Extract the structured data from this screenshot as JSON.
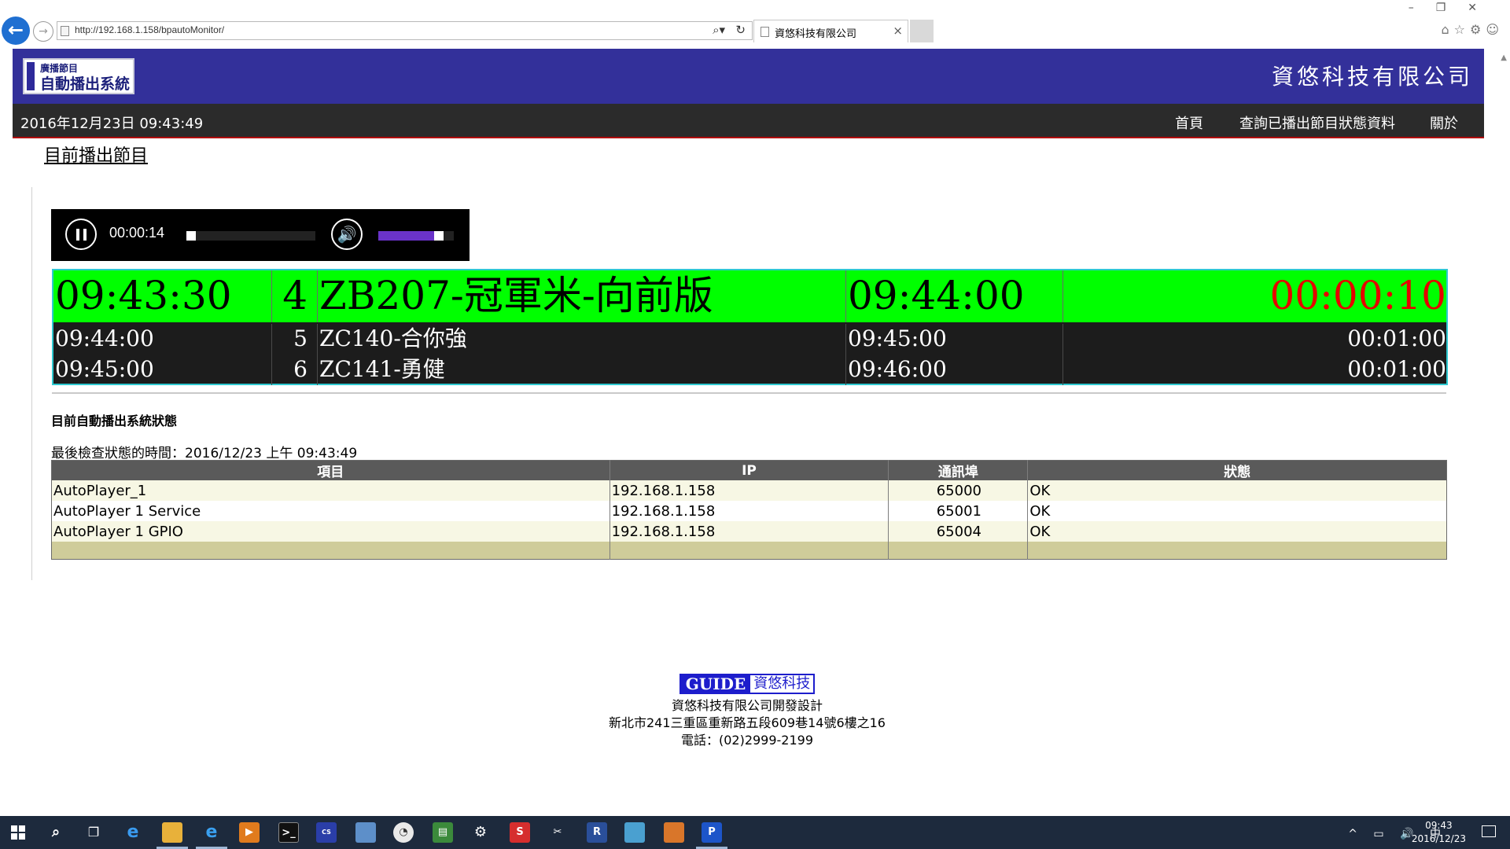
{
  "browser": {
    "url": "http://192.168.1.158/bpautoMonitor/",
    "tab_title": "資悠科技有限公司"
  },
  "header": {
    "logo_line1": "廣播節目",
    "logo_line2": "自動播出系統",
    "company": "資悠科技有限公司"
  },
  "nav": {
    "clock": "2016年12月23日 09:43:49",
    "items": [
      "首頁",
      "查詢已播出節目狀態資料",
      "關於"
    ]
  },
  "section_title": "目前播出節目",
  "player": {
    "time": "00:00:14",
    "seek_progress": 0.0,
    "volume": 0.85
  },
  "schedule": {
    "current": {
      "start": "09:43:30",
      "number": "4",
      "title": "ZB207-冠軍米-向前版",
      "end": "09:44:00",
      "remaining": "00:00:10"
    },
    "next": [
      {
        "start": "09:44:00",
        "number": "5",
        "title": "ZC140-合你強",
        "end": "09:45:00",
        "duration": "00:01:00"
      },
      {
        "start": "09:45:00",
        "number": "6",
        "title": "ZC141-勇健",
        "end": "09:46:00",
        "duration": "00:01:00"
      }
    ]
  },
  "status": {
    "heading": "目前自動播出系統狀態",
    "last_check_label": "最後檢查狀態的時間：",
    "last_check_value": "2016/12/23 上午 09:43:49",
    "columns": [
      "項目",
      "IP",
      "通訊埠",
      "狀態"
    ],
    "rows": [
      {
        "item": "AutoPlayer_1",
        "ip": "192.168.1.158",
        "port": "65000",
        "state": "OK"
      },
      {
        "item": "AutoPlayer 1 Service",
        "ip": "192.168.1.158",
        "port": "65001",
        "state": "OK"
      },
      {
        "item": "AutoPlayer 1 GPIO",
        "ip": "192.168.1.158",
        "port": "65004",
        "state": "OK"
      }
    ]
  },
  "footer": {
    "logo_en": "GUIDE",
    "logo_cn": "資悠科技",
    "line1": "資悠科技有限公司開發設計",
    "line2": "新北市241三重區重新路五段609巷14號6樓之16",
    "line3": "電話：(02)2999-2199"
  },
  "taskbar": {
    "time": "09:43",
    "date": "2016/12/23",
    "ime": "中"
  },
  "colors": {
    "header_bg": "#33309a",
    "nav_bg": "#2b2b2b",
    "current_row_bg": "#00ff00",
    "remaining_color": "#e60000",
    "schedule_border": "#2ec9d0"
  }
}
